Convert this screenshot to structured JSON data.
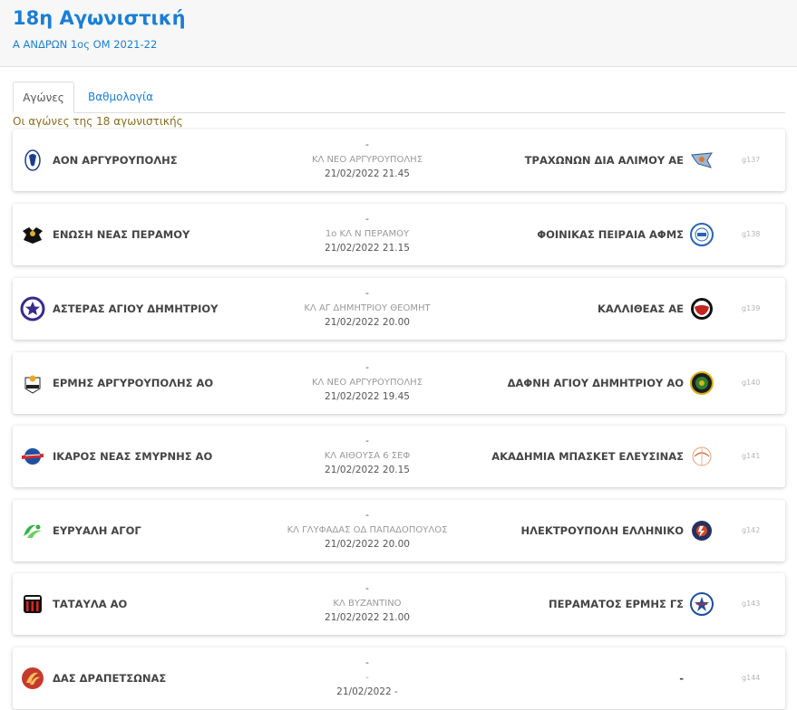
{
  "header": {
    "title": "18η Αγωνιστική",
    "subtitle": "Α ΑΝΔΡΩΝ 1ος ΟΜ 2021-22"
  },
  "tabs": [
    {
      "label": "Αγώνες",
      "active": true
    },
    {
      "label": "Βαθμολογία",
      "active": false
    }
  ],
  "section_label": "Οι αγώνες της 18 αγωνιστικής",
  "matches": [
    {
      "home": "ΑΟΝ ΑΡΓΥΡΟΥΠΟΛΗΣ",
      "away": "ΤΡΑΧΩΝΩΝ ΔΙΑ ΑΛΙΜΟΥ ΑΕ",
      "score": "-",
      "venue": "ΚΛ ΝΕΟ ΑΡΓΥΡΟΥΠΟΛΗΣ",
      "datetime": "21/02/2022 21.45",
      "code": "g137",
      "home_icon": "aon-crest-icon",
      "away_icon": "trachones-eagle-icon"
    },
    {
      "home": "ΕΝΩΣΗ ΝΕΑΣ ΠΕΡΑΜΟΥ",
      "away": "ΦΟΙΝΙΚΑΣ ΠΕΙΡΑΙΑ ΑΦΜΣ",
      "score": "-",
      "venue": "1ο ΚΛ Ν ΠΕΡΑΜΟΥ",
      "datetime": "21/02/2022 21.15",
      "code": "g138",
      "home_icon": "double-eagle-icon",
      "away_icon": "foinikas-1949-icon"
    },
    {
      "home": "ΑΣΤΕΡΑΣ ΑΓΙΟΥ ΔΗΜΗΤΡΙΟΥ",
      "away": "ΚΑΛΛΙΘΕΑΣ ΑΕ",
      "score": "-",
      "venue": "ΚΛ ΑΓ ΔΗΜΗΤΡΙΟΥ ΘΕΟΜΗΤ",
      "datetime": "21/02/2022 20.00",
      "code": "g139",
      "home_icon": "star-crest-icon",
      "away_icon": "kallithea-crest-icon"
    },
    {
      "home": "ΕΡΜΗΣ ΑΡΓΥΡΟΥΠΟΛΗΣ ΑΟ",
      "away": "ΔΑΦΝΗ ΑΓΙΟΥ ΔΗΜΗΤΡΙΟΥ ΑΟ",
      "score": "-",
      "venue": "ΚΛ ΝΕΟ ΑΡΓΥΡΟΥΠΟΛΗΣ",
      "datetime": "21/02/2022 19.45",
      "code": "g140",
      "home_icon": "ermis-crest-icon",
      "away_icon": "dafni-crest-icon"
    },
    {
      "home": "ΙΚΑΡΟΣ ΝΕΑΣ ΣΜΥΡΝΗΣ ΑΟ",
      "away": "ΑΚΑΔΗΜΙΑ ΜΠΑΣΚΕΤ ΕΛΕΥΣΙΝΑΣ",
      "score": "-",
      "venue": "ΚΛ ΑΙΘΟΥΣΑ 6 ΣΕΦ",
      "datetime": "21/02/2022 20.15",
      "code": "g141",
      "home_icon": "ikaros-crest-icon",
      "away_icon": "akadimia-crest-icon"
    },
    {
      "home": "ΕΥΡΥΑΛΗ ΑΓΟΓ",
      "away": "ΗΛΕΚΤΡΟΥΠΟΛΗ ΕΛΛΗΝΙΚΟ",
      "score": "-",
      "venue": "ΚΛ ΓΛΥΦΑΔΑΣ ΟΔ ΠΑΠΑΔΟΠΟΥΛΟΣ",
      "datetime": "21/02/2022 20.00",
      "code": "g142",
      "home_icon": "euryali-logo-icon",
      "away_icon": "ilektroupoli-crest-icon"
    },
    {
      "home": "ΤΑΤΑΥΛΑ ΑΟ",
      "away": "ΠΕΡΑΜΑΤΟΣ ΕΡΜΗΣ ΓΣ",
      "score": "-",
      "venue": "ΚΛ ΒΥΖΑΝΤΙΝΟ",
      "datetime": "21/02/2022 21.00",
      "code": "g143",
      "home_icon": "tatavla-crest-icon",
      "away_icon": "peramatos-crest-icon"
    },
    {
      "home": "ΔΑΣ ΔΡΑΠΕΤΣΩΝΑΣ",
      "away": "-",
      "score": "-",
      "venue": "-",
      "datetime": "21/02/2022 -",
      "code": "g144",
      "home_icon": "das-crest-icon",
      "away_icon": ""
    }
  ],
  "colors": {
    "accent": "#1a7fd4",
    "section_label": "#8a6d1e"
  }
}
